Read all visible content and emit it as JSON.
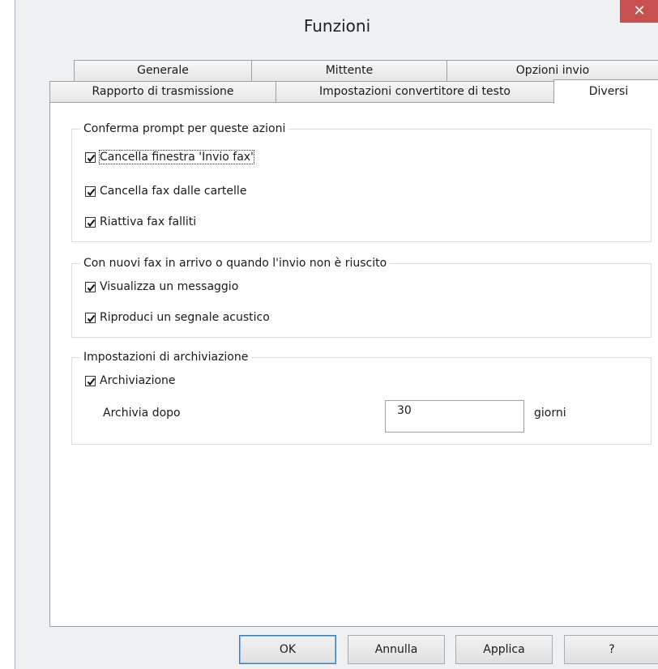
{
  "window": {
    "title": "Funzioni",
    "close_glyph": "✕"
  },
  "tabs_row1": [
    {
      "label": "Generale"
    },
    {
      "label": "Mittente"
    },
    {
      "label": "Opzioni invio"
    }
  ],
  "tabs_row2": [
    {
      "label": "Rapporto di trasmissione"
    },
    {
      "label": "Impostazioni convertitore di testo"
    },
    {
      "label": "Diversi",
      "active": true
    }
  ],
  "confirm_group": {
    "title": "Conferma prompt per queste azioni",
    "items": [
      {
        "label": "Cancella finestra 'Invio fax'",
        "checked": true
      },
      {
        "label": "Cancella fax dalle cartelle",
        "checked": true
      },
      {
        "label": "Riattiva fax falliti",
        "checked": true
      }
    ]
  },
  "notify_group": {
    "title": "Con nuovi fax in arrivo o quando l'invio non è riuscito",
    "items": [
      {
        "label": "Visualizza un messaggio",
        "checked": true
      },
      {
        "label": "Riproduci un segnale acustico",
        "checked": true
      }
    ]
  },
  "archive_group": {
    "title": "Impostazioni di archiviazione",
    "archive_label": "Archiviazione",
    "archive_checked": true,
    "archive_after_label": "Archivia dopo",
    "archive_after_value": "30",
    "unit_label": "giorni"
  },
  "buttons": {
    "ok": "OK",
    "cancel": "Annulla",
    "apply": "Applica",
    "help": "?"
  },
  "icons": {
    "checkbox_check": "checkmark-icon",
    "close": "close-icon"
  }
}
